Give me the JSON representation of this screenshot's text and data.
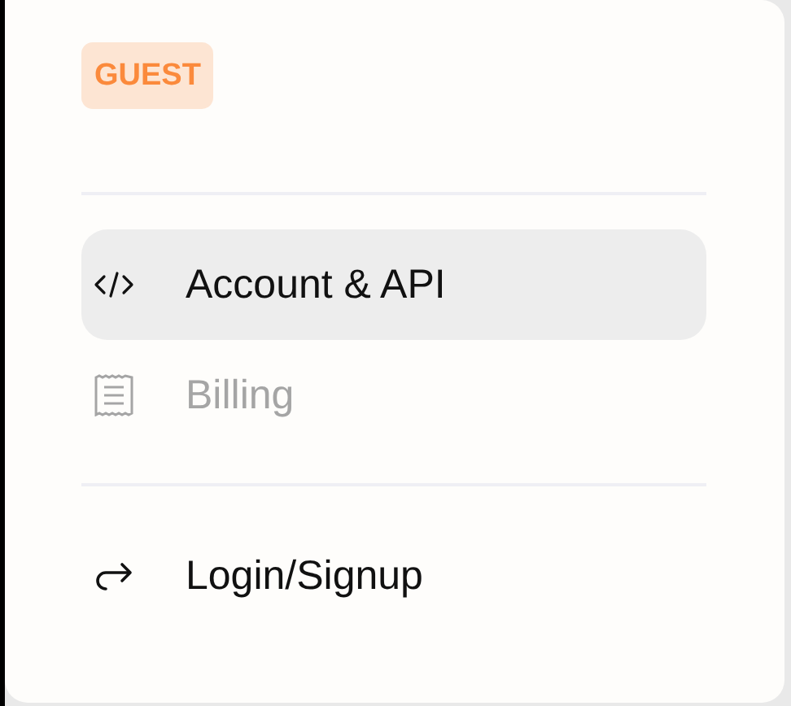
{
  "badge": "GUEST",
  "sections": [
    {
      "items": [
        {
          "kind": "code",
          "label": "Account & API",
          "selected": true,
          "disabled": false
        },
        {
          "kind": "receipt",
          "label": "Billing",
          "selected": false,
          "disabled": true
        }
      ]
    },
    {
      "items": [
        {
          "kind": "login",
          "label": "Login/Signup",
          "selected": false,
          "disabled": false
        }
      ]
    }
  ]
}
